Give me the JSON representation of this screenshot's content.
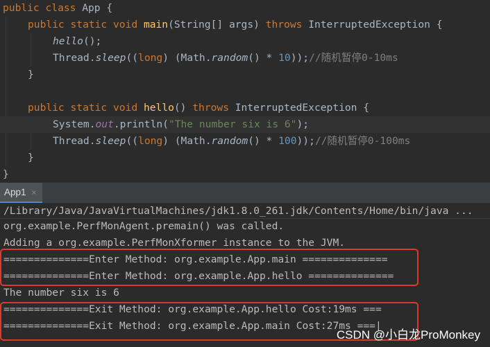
{
  "code": {
    "line1": {
      "kw": "public class ",
      "name": "App",
      "brace": " {"
    },
    "line2": {
      "kw1": "public static void ",
      "fn": "main",
      "p1": "(String[] args) ",
      "kw2": "throws",
      "p2": " InterruptedException {"
    },
    "line3": {
      "call": "hello",
      "tail": "();"
    },
    "line4": {
      "cls": "Thread.",
      "method": "sleep",
      "p1": "((",
      "kw": "long",
      "p2": ") (Math.",
      "rnd": "random",
      "p3": "() * ",
      "num": "10",
      "p4": "));",
      "comment": "//随机暂停0-10ms"
    },
    "line5": {
      "brace": "}"
    },
    "line7": {
      "kw1": "public static void ",
      "fn": "hello",
      "p1": "() ",
      "kw2": "throws",
      "p2": " InterruptedException {"
    },
    "line8": {
      "cls": "System.",
      "field": "out",
      "p1": ".println(",
      "str": "\"The number six is 6\"",
      "p2": ");"
    },
    "line9": {
      "cls": "Thread.",
      "method": "sleep",
      "p1": "((",
      "kw": "long",
      "p2": ") (Math.",
      "rnd": "random",
      "p3": "() * ",
      "num": "100",
      "p4": "));",
      "comment": "//随机暂停0-100ms"
    },
    "line10": {
      "brace": "}"
    },
    "line11": {
      "brace": "}"
    }
  },
  "run_tab": {
    "label": "App1",
    "close": "×"
  },
  "console": {
    "lines": [
      "/Library/Java/JavaVirtualMachines/jdk1.8.0_261.jdk/Contents/Home/bin/java ...",
      "org.example.PerfMonAgent.premain() was called.",
      "Adding a org.example.PerfMonXformer instance to the JVM.",
      "==============Enter Method: org.example.App.main ==============",
      "==============Enter Method: org.example.App.hello ==============",
      "The number six is 6",
      "==============Exit Method: org.example.App.hello Cost:19ms ===",
      "==============Exit Method: org.example.App.main Cost:27ms ===|"
    ]
  },
  "watermark": "CSDN @小白龙ProMonkey",
  "colors": {
    "keyword": "#cc7832",
    "function": "#ffc66d",
    "number": "#6897bb",
    "string": "#6a8759",
    "comment": "#808080",
    "highlight_box": "#e0382e"
  }
}
